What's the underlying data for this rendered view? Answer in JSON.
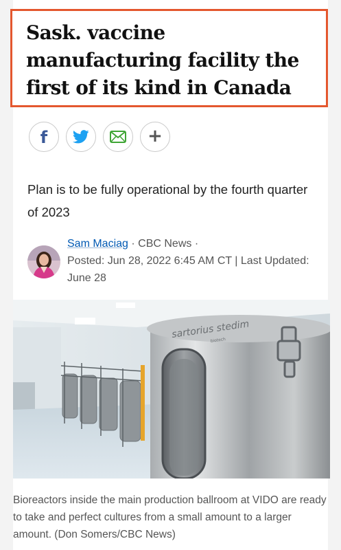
{
  "headline": "Sask. vaccine manufacturing facility the first of its kind in Canada",
  "share": {
    "buttons": [
      {
        "name": "facebook",
        "icon": "facebook-icon",
        "glyph": "f",
        "color": "#3b5998"
      },
      {
        "name": "twitter",
        "icon": "twitter-icon",
        "color": "#1da1f2"
      },
      {
        "name": "email",
        "icon": "email-icon",
        "color": "#3fa535"
      },
      {
        "name": "more",
        "icon": "plus-icon",
        "glyph": "+",
        "color": "#555555"
      }
    ]
  },
  "dek": "Plan is to be fully operational by the fourth quarter of 2023",
  "byline": {
    "author": "Sam Maciag",
    "sep1": " · ",
    "outlet": "CBC News",
    "sep2": " ·",
    "posted": "Posted: Jun 28, 2022 6:45 AM CT | Last Updated: June 28"
  },
  "photo": {
    "equipment_brand": "sartorius stedim",
    "equipment_sub": "biotech"
  },
  "caption": "Bioreactors inside the main production ballroom at VIDO are ready to take and perfect cultures from a small amount to a larger amount. (Don Somers/CBC News)",
  "colors": {
    "headline_border": "#e4572e",
    "link": "#0059b3"
  }
}
